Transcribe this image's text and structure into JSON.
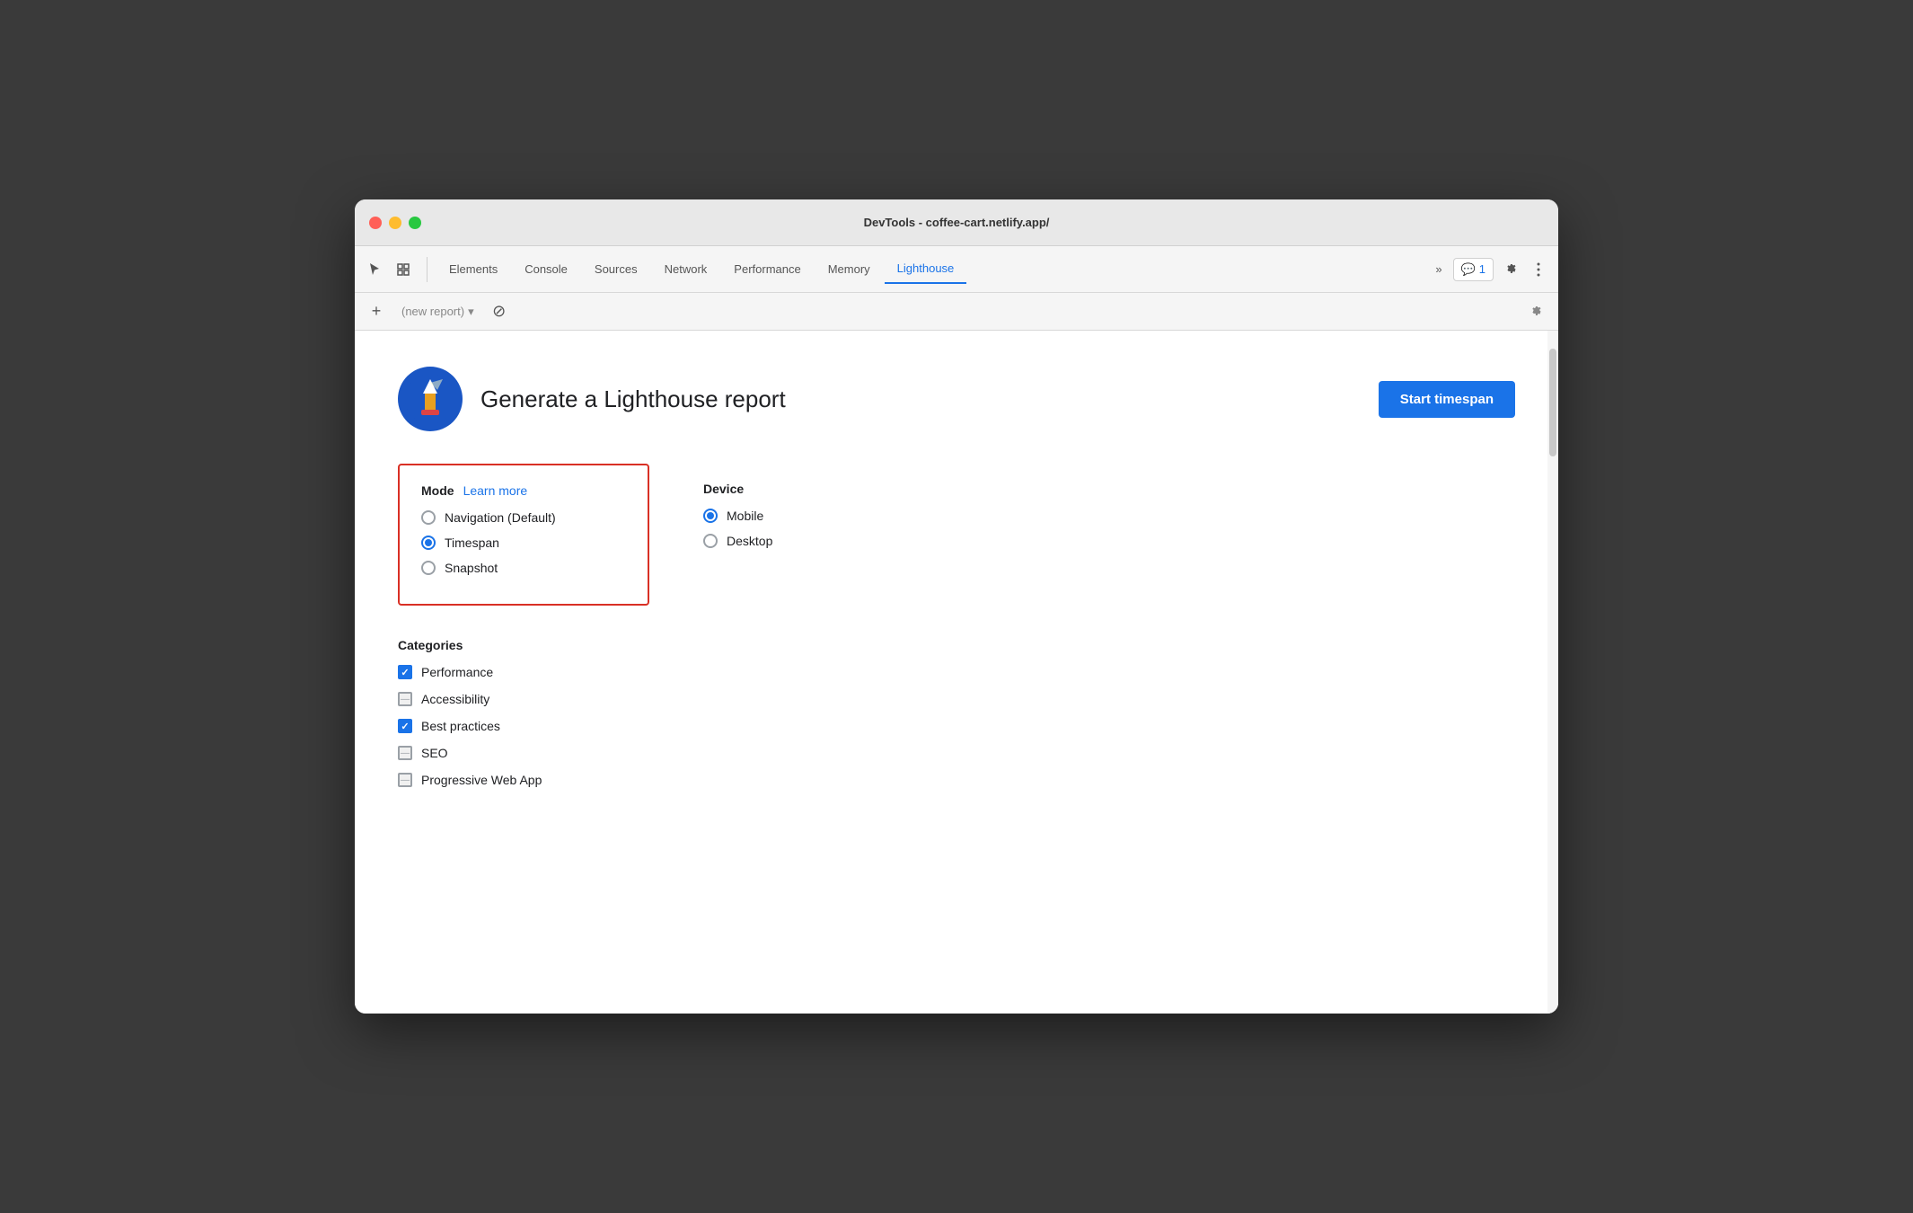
{
  "window": {
    "title": "DevTools - coffee-cart.netlify.app/"
  },
  "tabs": [
    {
      "id": "elements",
      "label": "Elements",
      "active": false
    },
    {
      "id": "console",
      "label": "Console",
      "active": false
    },
    {
      "id": "sources",
      "label": "Sources",
      "active": false
    },
    {
      "id": "network",
      "label": "Network",
      "active": false
    },
    {
      "id": "performance",
      "label": "Performance",
      "active": false
    },
    {
      "id": "memory",
      "label": "Memory",
      "active": false
    },
    {
      "id": "lighthouse",
      "label": "Lighthouse",
      "active": true
    }
  ],
  "more_tabs_label": "»",
  "badge": {
    "icon": "💬",
    "count": "1"
  },
  "sub_tab": {
    "add_label": "+",
    "report_placeholder": "(new report)",
    "delete_label": "⊘"
  },
  "header": {
    "logo_emoji": "🏠",
    "title": "Generate a Lighthouse report",
    "start_button": "Start timespan"
  },
  "mode": {
    "title": "Mode",
    "learn_more": "Learn more",
    "options": [
      {
        "id": "navigation",
        "label": "Navigation (Default)",
        "checked": false
      },
      {
        "id": "timespan",
        "label": "Timespan",
        "checked": true
      },
      {
        "id": "snapshot",
        "label": "Snapshot",
        "checked": false
      }
    ]
  },
  "device": {
    "title": "Device",
    "options": [
      {
        "id": "mobile",
        "label": "Mobile",
        "checked": true
      },
      {
        "id": "desktop",
        "label": "Desktop",
        "checked": false
      }
    ]
  },
  "categories": {
    "title": "Categories",
    "items": [
      {
        "id": "performance",
        "label": "Performance",
        "state": "checked"
      },
      {
        "id": "accessibility",
        "label": "Accessibility",
        "state": "indeterminate"
      },
      {
        "id": "best-practices",
        "label": "Best practices",
        "state": "checked"
      },
      {
        "id": "seo",
        "label": "SEO",
        "state": "indeterminate"
      },
      {
        "id": "pwa",
        "label": "Progressive Web App",
        "state": "indeterminate"
      }
    ]
  }
}
